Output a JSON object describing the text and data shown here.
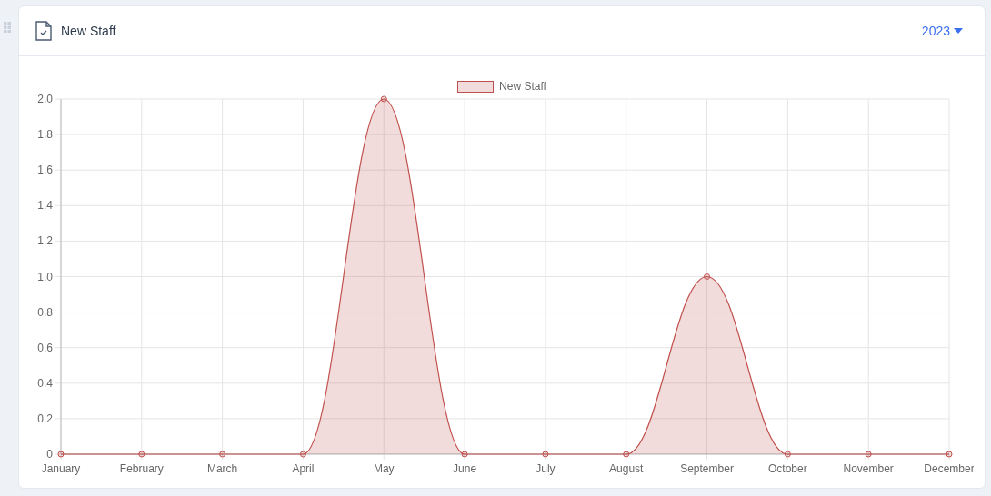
{
  "card": {
    "title": "New Staff",
    "year_selector": {
      "value": "2023"
    }
  },
  "chart_data": {
    "type": "area",
    "categories": [
      "January",
      "February",
      "March",
      "April",
      "May",
      "June",
      "July",
      "August",
      "September",
      "October",
      "November",
      "December"
    ],
    "series": [
      {
        "name": "New Staff",
        "color": "#c0504d",
        "values": [
          0,
          0,
          0,
          0,
          2,
          0,
          0,
          0,
          1,
          0,
          0,
          0
        ]
      }
    ],
    "grid": true,
    "ylim": [
      0,
      2
    ],
    "yticks": [
      {
        "value": 0,
        "label": "0"
      },
      {
        "value": 0.2,
        "label": "0.2"
      },
      {
        "value": 0.4,
        "label": "0.4"
      },
      {
        "value": 0.6,
        "label": "0.6"
      },
      {
        "value": 0.8,
        "label": "0.8"
      },
      {
        "value": 1,
        "label": "1.0"
      },
      {
        "value": 1.2,
        "label": "1.2"
      },
      {
        "value": 1.4,
        "label": "1.4"
      },
      {
        "value": 1.6,
        "label": "1.6"
      },
      {
        "value": 1.8,
        "label": "1.8"
      },
      {
        "value": 2,
        "label": "2.0"
      }
    ]
  }
}
